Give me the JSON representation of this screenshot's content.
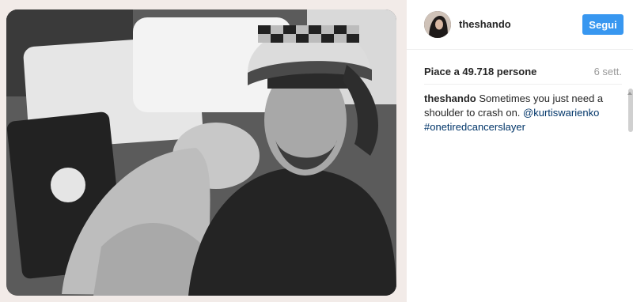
{
  "post": {
    "photo_alt": "Black and white photo of a man in a knit hat with a woman sleeping on his shoulder",
    "username": "theshando",
    "follow_label": "Segui",
    "likes": "Piace a 49.718 persone",
    "timestamp": "6 sett.",
    "caption": {
      "user": "theshando",
      "text": "Sometimes you just need a shoulder to crash on.",
      "mention": "@kurtiswarienko",
      "hashtag": "#onetiredcancerslayer"
    }
  },
  "colors": {
    "follow_button": "#3897f0",
    "link": "#003569",
    "page_background": "#f2ebe8"
  }
}
